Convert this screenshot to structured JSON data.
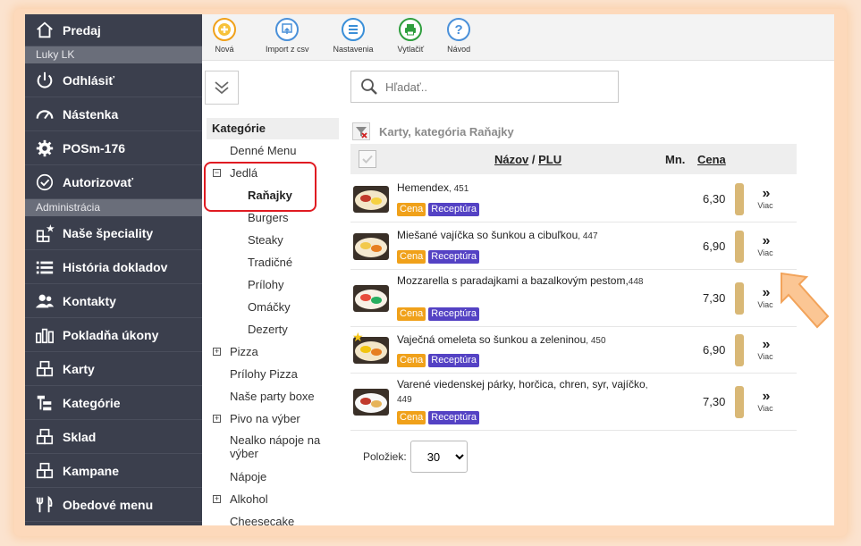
{
  "sidebar": {
    "app_title": "Predaj",
    "user": "Luky LK",
    "logout": "Odhlásiť",
    "items_top": [
      {
        "label": "Nástenka",
        "icon": "dashboard-icon"
      },
      {
        "label": "POSm-176",
        "icon": "gear-icon"
      },
      {
        "label": "Autorizovať",
        "icon": "check-circle-icon"
      }
    ],
    "section_admin": "Administrácia",
    "items_admin": [
      {
        "label": "Naše špeciality",
        "icon": "specialty-icon"
      },
      {
        "label": "História dokladov",
        "icon": "list-icon"
      },
      {
        "label": "Kontakty",
        "icon": "contacts-icon"
      },
      {
        "label": "Pokladňa úkony",
        "icon": "bar-chart-icon"
      },
      {
        "label": "Karty",
        "icon": "cards-icon"
      },
      {
        "label": "Kategórie",
        "icon": "category-tree-icon"
      },
      {
        "label": "Sklad",
        "icon": "warehouse-icon"
      },
      {
        "label": "Kampane",
        "icon": "campaign-icon"
      },
      {
        "label": "Obedové menu",
        "icon": "cutlery-icon"
      }
    ]
  },
  "toolbar": {
    "new_label": "Nová",
    "import_label": "Import z csv",
    "settings_label": "Nastavenia",
    "print_label": "Vytlačiť",
    "help_label": "Návod",
    "colors": {
      "new": "#f0a11a",
      "import": "#4a90d9",
      "settings": "#3a8fd8",
      "print": "#2e9e3d",
      "help": "#4a90d9"
    }
  },
  "search": {
    "placeholder": "Hľadať.."
  },
  "categories": {
    "header": "Kategórie",
    "items": [
      {
        "label": "Denné Menu",
        "level": 0,
        "expander": ""
      },
      {
        "label": "Jedlá",
        "level": 0,
        "expander": "−"
      },
      {
        "label": "Raňajky",
        "level": 1,
        "expander": "",
        "selected": true
      },
      {
        "label": "Burgers",
        "level": 1,
        "expander": ""
      },
      {
        "label": "Steaky",
        "level": 1,
        "expander": ""
      },
      {
        "label": "Tradičné",
        "level": 1,
        "expander": ""
      },
      {
        "label": "Prílohy",
        "level": 1,
        "expander": ""
      },
      {
        "label": "Omáčky",
        "level": 1,
        "expander": ""
      },
      {
        "label": "Dezerty",
        "level": 1,
        "expander": ""
      },
      {
        "label": "Pizza",
        "level": 0,
        "expander": "+"
      },
      {
        "label": "Prílohy Pizza",
        "level": 0,
        "expander": ""
      },
      {
        "label": "Naše party boxe",
        "level": 0,
        "expander": ""
      },
      {
        "label": "Pivo na výber",
        "level": 0,
        "expander": "+"
      },
      {
        "label": "Nealko nápoje na výber",
        "level": 0,
        "expander": ""
      },
      {
        "label": "Nápoje",
        "level": 0,
        "expander": ""
      },
      {
        "label": "Alkohol",
        "level": 0,
        "expander": "+"
      },
      {
        "label": "Cheesecake",
        "level": 0,
        "expander": ""
      }
    ]
  },
  "list": {
    "title": "Karty, kategória Raňajky",
    "col_name": "Názov",
    "col_sep": " / ",
    "col_plu": "PLU",
    "col_qty": "Mn.",
    "col_price": "Cena",
    "badge_price": "Cena",
    "badge_recipe": "Receptúra",
    "more_label": "Viac",
    "more_icon": "»",
    "rows": [
      {
        "name": "Hemendex",
        "plu": ", 451",
        "price": "6,30"
      },
      {
        "name": "Miešané vajíčka so šunkou a cibuľkou",
        "plu": ", 447",
        "price": "6,90"
      },
      {
        "name": "Mozzarella s paradajkami a bazalkovým pestom,",
        "plu": "448",
        "price": "7,30"
      },
      {
        "name": "Vaječná omeleta so šunkou a zeleninou",
        "plu": ", 450",
        "price": "6,90"
      },
      {
        "name": "Varené viedenskej párky, horčica, chren, syr, vajíčko",
        "plu": ", 449",
        "price": "7,30"
      }
    ]
  },
  "footer": {
    "label": "Položiek:",
    "page_size": "30"
  }
}
